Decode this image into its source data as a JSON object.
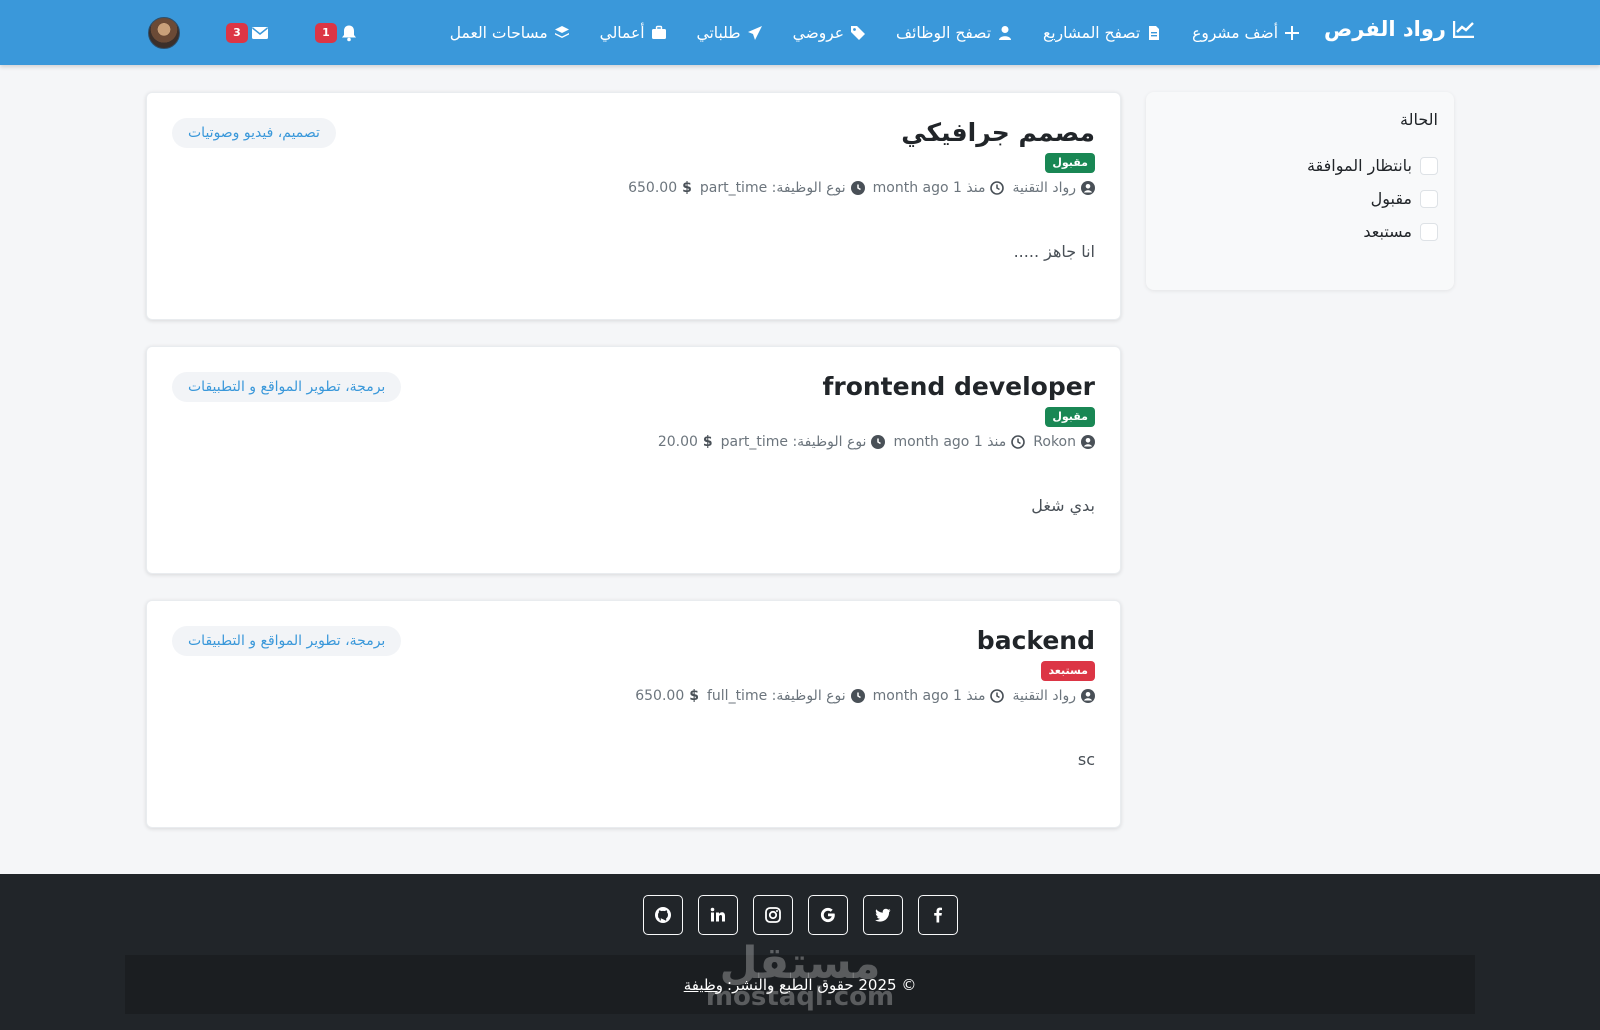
{
  "navbar": {
    "brand": "رواد الفرص",
    "items": [
      {
        "label": "أضف مشروع",
        "icon": "plus-icon"
      },
      {
        "label": "تصفح المشاريع",
        "icon": "file-icon"
      },
      {
        "label": "تصفح الوظائف",
        "icon": "user-tie-icon"
      },
      {
        "label": "عروضي",
        "icon": "tags-icon"
      },
      {
        "label": "طلباتي",
        "icon": "paper-plane-icon"
      },
      {
        "label": "أعمالي",
        "icon": "briefcase-icon"
      },
      {
        "label": "مساحات العمل",
        "icon": "layers-icon"
      }
    ],
    "notifications_count": "1",
    "messages_count": "3"
  },
  "filter": {
    "title": "الحالة",
    "options": [
      "بانتظار الموافقة",
      "مقبول",
      "مستبعد"
    ]
  },
  "applications": [
    {
      "title": "مصمم جرافيكي",
      "status": "مقبول",
      "status_color": "#198754",
      "company": "رواد التقنية",
      "time": "منذ 1 month ago",
      "job_type": "نوع الوظيفة: part_time",
      "price": "650.00",
      "currency": "$",
      "description": "انا جاهز .....",
      "category": "تصميم، فيديو وصوتيات"
    },
    {
      "title": "frontend developer",
      "status": "مقبول",
      "status_color": "#198754",
      "company": "Rokon",
      "time": "منذ 1 month ago",
      "job_type": "نوع الوظيفة: part_time",
      "price": "20.00",
      "currency": "$",
      "description": "بدي شغل",
      "category": "برمجة، تطوير المواقع و التطبيقات"
    },
    {
      "title": "backend",
      "status": "مستبعد",
      "status_color": "#dc3545",
      "company": "رواد التقنية",
      "time": "منذ 1 month ago",
      "job_type": "نوع الوظيفة: full_time",
      "price": "650.00",
      "currency": "$",
      "description": "sc",
      "category": "برمجة، تطوير المواقع و التطبيقات"
    }
  ],
  "footer": {
    "social": [
      "github-icon",
      "linkedin-icon",
      "instagram-icon",
      "google-icon",
      "twitter-icon",
      "facebook-icon"
    ],
    "copyright_prefix": "© 2025 حقوق الطبع والنشر:",
    "copyright_link": "وظيفة",
    "watermark_ar": "مستقل",
    "watermark_en": "mostaql.com"
  },
  "colors": {
    "navbar": "#3a98da",
    "accent": "#3a98da",
    "accepted": "#198754",
    "rejected": "#dc3545",
    "footer": "#212529"
  }
}
